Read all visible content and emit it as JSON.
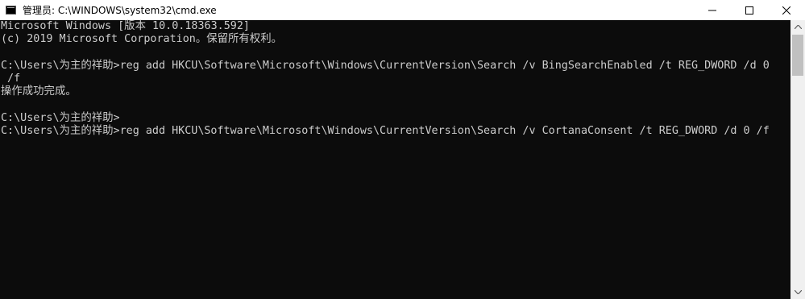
{
  "window": {
    "title": "管理员: C:\\WINDOWS\\system32\\cmd.exe",
    "icon": "cmd-icon"
  },
  "controls": {
    "minimize": "minimize-icon",
    "maximize": "maximize-icon",
    "close": "close-icon"
  },
  "console": {
    "lines": [
      "Microsoft Windows [版本 10.0.18363.592]",
      "(c) 2019 Microsoft Corporation。保留所有权利。",
      "",
      "C:\\Users\\为主的祥助>reg add HKCU\\Software\\Microsoft\\Windows\\CurrentVersion\\Search /v BingSearchEnabled /t REG_DWORD /d 0",
      " /f",
      "操作成功完成。",
      "",
      "C:\\Users\\为主的祥助>",
      "C:\\Users\\为主的祥助>reg add HKCU\\Software\\Microsoft\\Windows\\CurrentVersion\\Search /v CortanaConsent /t REG_DWORD /d 0 /f"
    ]
  },
  "colors": {
    "background": "#0c0c0c",
    "text": "#cccccc",
    "titlebar": "#ffffff"
  }
}
